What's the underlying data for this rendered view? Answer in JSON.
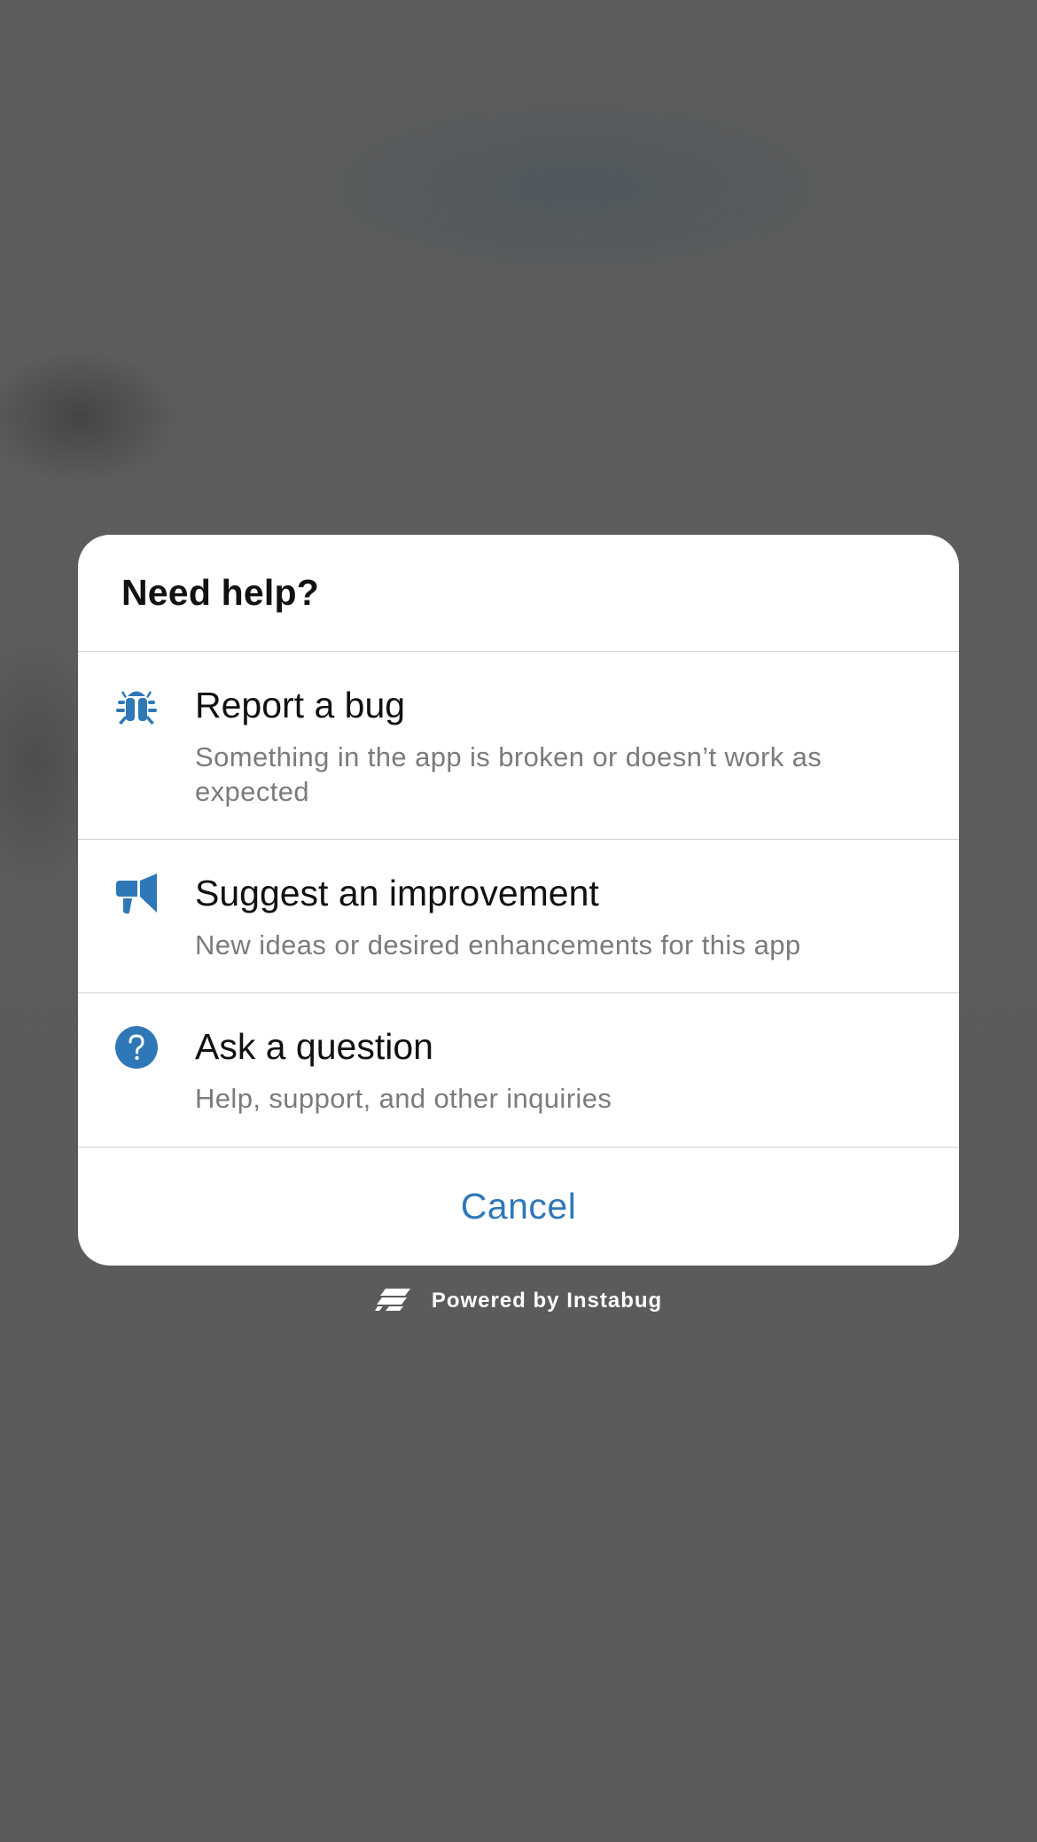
{
  "dialog": {
    "title": "Need help?",
    "options": [
      {
        "icon": "bug-icon",
        "title": "Report a bug",
        "description": "Something in the app is broken or doesn’t work as expected"
      },
      {
        "icon": "megaphone-icon",
        "title": "Suggest an improvement",
        "description": "New ideas or desired enhancements for this app"
      },
      {
        "icon": "question-circle-icon",
        "title": "Ask a question",
        "description": "Help, support, and other inquiries"
      }
    ],
    "cancel_label": "Cancel"
  },
  "footer": {
    "logo_icon": "instabug-logo-icon",
    "powered_by": "Powered by Instabug"
  },
  "colors": {
    "accent": "#2f78b8",
    "icon": "#2f78b8",
    "overlay": "#5a5a5a",
    "sheet": "#ffffff",
    "description_text": "#7b7b7f"
  }
}
